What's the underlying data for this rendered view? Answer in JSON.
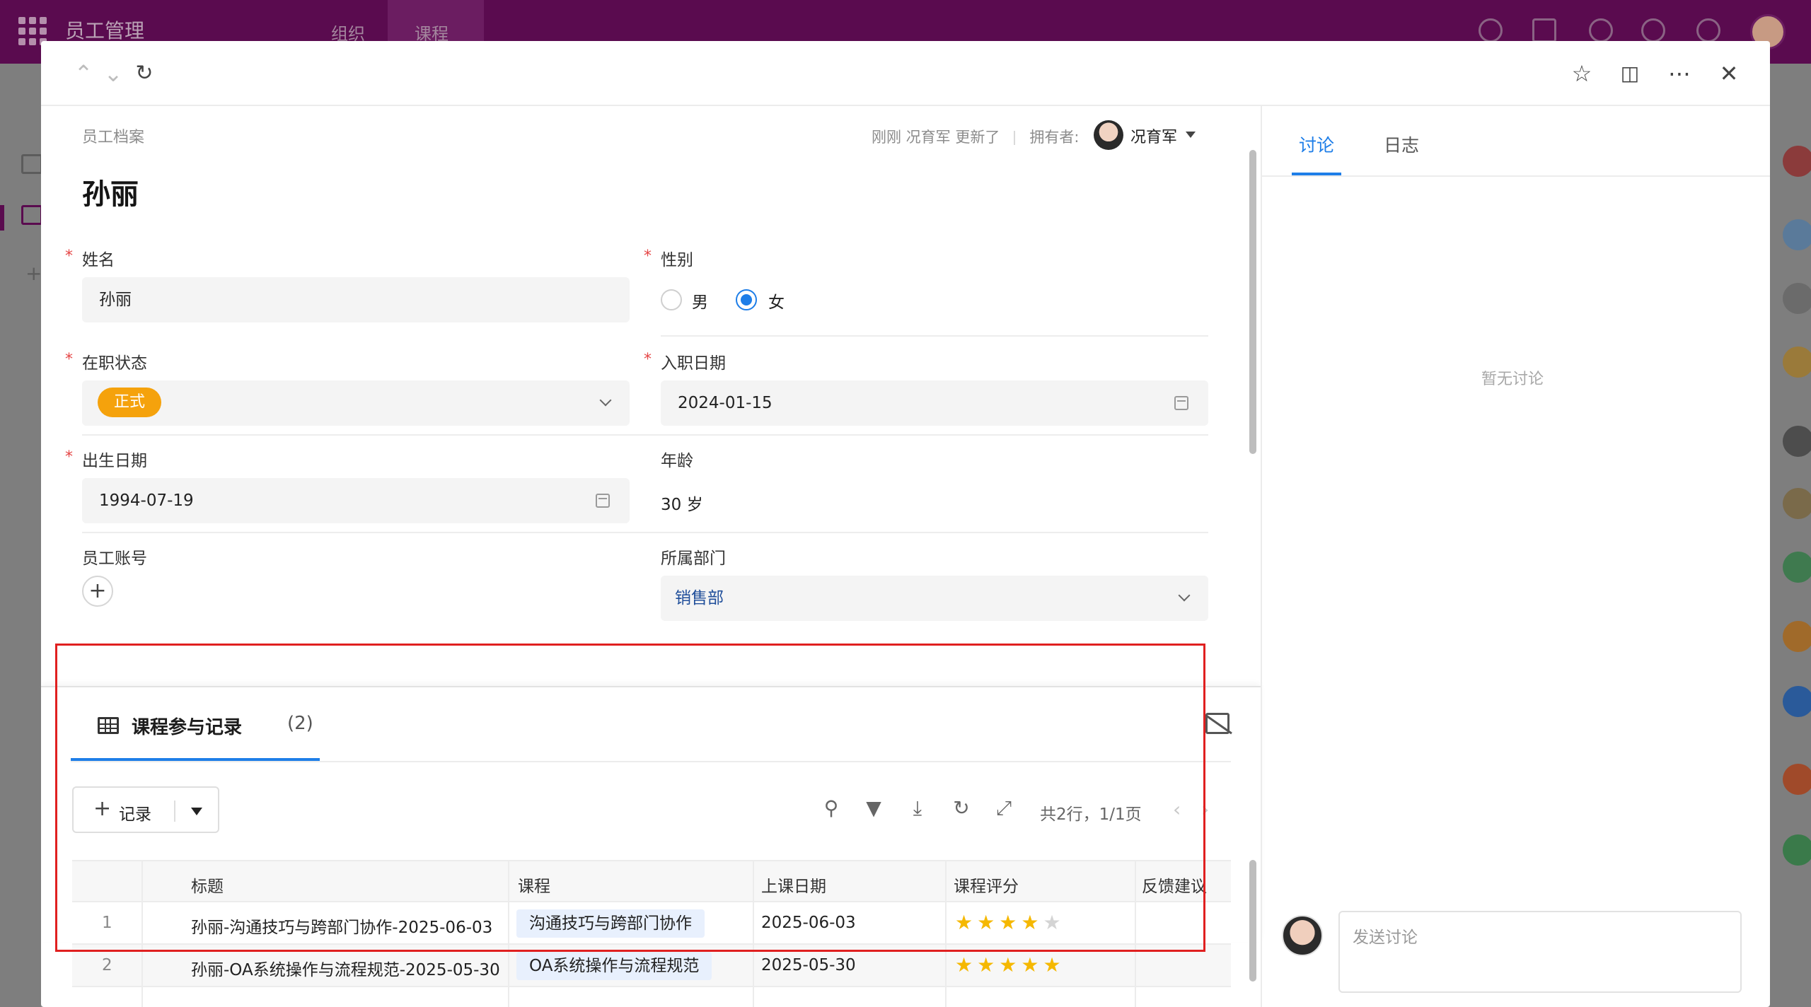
{
  "appbar": {
    "app_title": "员工管理",
    "nav": [
      "组织",
      "课程"
    ]
  },
  "header": {
    "up_icon": "chevron-up-icon",
    "down_icon": "chevron-down-icon",
    "refresh_icon": "refresh-icon",
    "star_icon": "star-icon",
    "panel_icon": "sidebar-toggle-icon",
    "more_icon": "more-icon",
    "close_icon": "close-icon"
  },
  "record": {
    "breadcrumb": "员工档案",
    "updated_text": "刚刚 况育军 更新了",
    "owner_label": "拥有者:",
    "owner_name": "况育军",
    "title": "孙丽"
  },
  "fields": {
    "name_label": "姓名",
    "name_value": "孙丽",
    "gender_label": "性别",
    "gender_options": [
      "男",
      "女"
    ],
    "gender_selected": "女",
    "status_label": "在职状态",
    "status_value": "正式",
    "status_color": "#f5a20c",
    "hire_date_label": "入职日期",
    "hire_date_value": "2024-01-15",
    "birth_label": "出生日期",
    "birth_value": "1994-07-19",
    "age_label": "年龄",
    "age_value": "30 岁",
    "account_label": "员工账号",
    "dept_label": "所属部门",
    "dept_value": "销售部"
  },
  "subtable": {
    "tab_title": "课程参与记录",
    "tab_count": "(2)",
    "add_label": "记录",
    "pager": "共2行，1/1页",
    "columns": [
      "标题",
      "课程",
      "上课日期",
      "课程评分",
      "反馈建议"
    ],
    "rows": [
      {
        "index": "1",
        "title": "孙丽-沟通技巧与跨部门协作-2025-06-03",
        "course": "沟通技巧与跨部门协作",
        "date": "2025-06-03",
        "rating": 4,
        "feedback": ""
      },
      {
        "index": "2",
        "title": "孙丽-OA系统操作与流程规范-2025-05-30",
        "course": "OA系统操作与流程规范",
        "date": "2025-05-30",
        "rating": 5,
        "feedback": ""
      }
    ],
    "rating_max": 5,
    "accent_color": "#1e7ee8",
    "star_color": "#f5b800"
  },
  "side": {
    "tabs": [
      "讨论",
      "日志"
    ],
    "active_tab": "讨论",
    "empty_text": "暂无讨论",
    "comment_placeholder": "发送讨论"
  }
}
